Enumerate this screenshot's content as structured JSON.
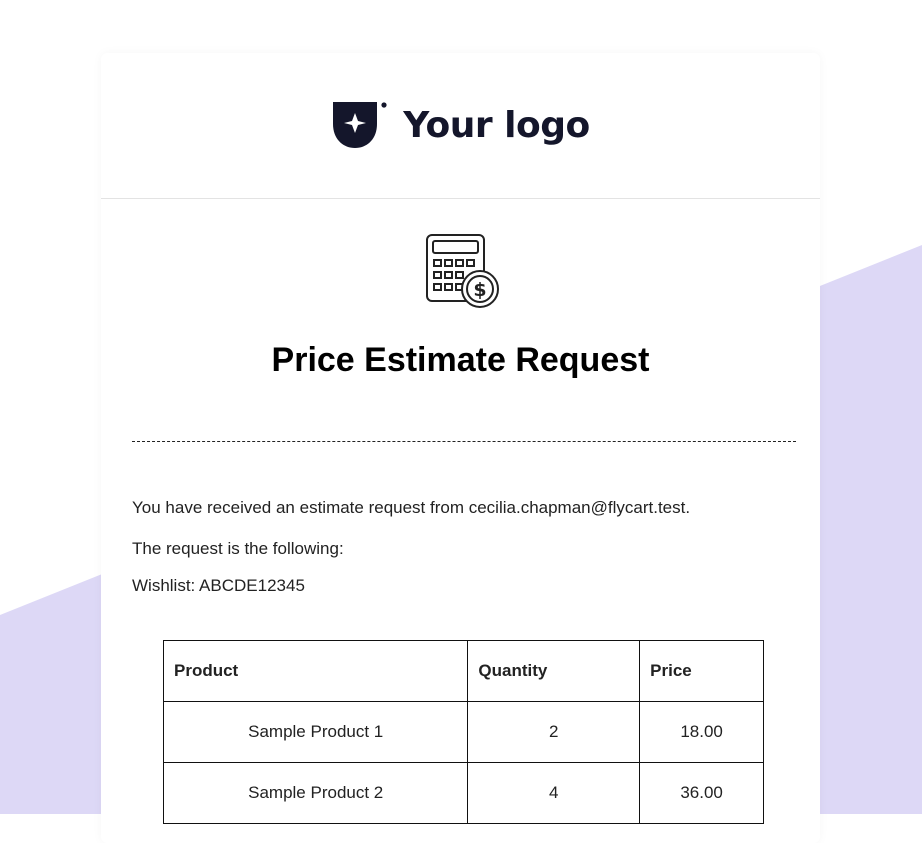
{
  "colors": {
    "background_shape": "#ddd8f6",
    "logo": "#14162b"
  },
  "logo": {
    "text": "Your logo"
  },
  "email": {
    "icon": "calculator-dollar-icon",
    "title": "Price Estimate Request",
    "intro": "You have received an estimate request from cecilia.chapman@flycart.test.",
    "request_line": "The request is the following:",
    "wishlist": "Wishlist: ABCDE12345"
  },
  "table": {
    "headers": [
      "Product",
      "Quantity",
      "Price"
    ],
    "rows": [
      [
        "Sample Product 1",
        "2",
        "18.00"
      ],
      [
        "Sample Product 2",
        "4",
        "36.00"
      ]
    ]
  }
}
